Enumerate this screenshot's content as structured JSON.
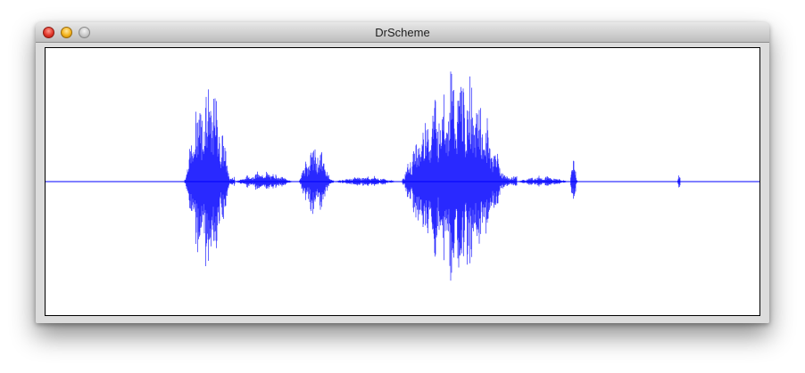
{
  "window": {
    "title": "DrScheme"
  },
  "titlebar_buttons": {
    "close": "close-icon",
    "minimize": "minimize-icon",
    "zoom": "zoom-icon"
  },
  "waveform": {
    "color": "#0000ff",
    "background": "#ffffff",
    "bursts": [
      {
        "start": 0.195,
        "end": 0.265,
        "amplitude": 0.38
      },
      {
        "start": 0.265,
        "end": 0.355,
        "amplitude": 0.035
      },
      {
        "start": 0.355,
        "end": 0.405,
        "amplitude": 0.13
      },
      {
        "start": 0.405,
        "end": 0.5,
        "amplitude": 0.02
      },
      {
        "start": 0.5,
        "end": 0.66,
        "amplitude": 0.4
      },
      {
        "start": 0.66,
        "end": 0.74,
        "amplitude": 0.02
      },
      {
        "start": 0.735,
        "end": 0.745,
        "amplitude": 0.1
      },
      {
        "start": 0.885,
        "end": 0.89,
        "amplitude": 0.03
      }
    ]
  }
}
